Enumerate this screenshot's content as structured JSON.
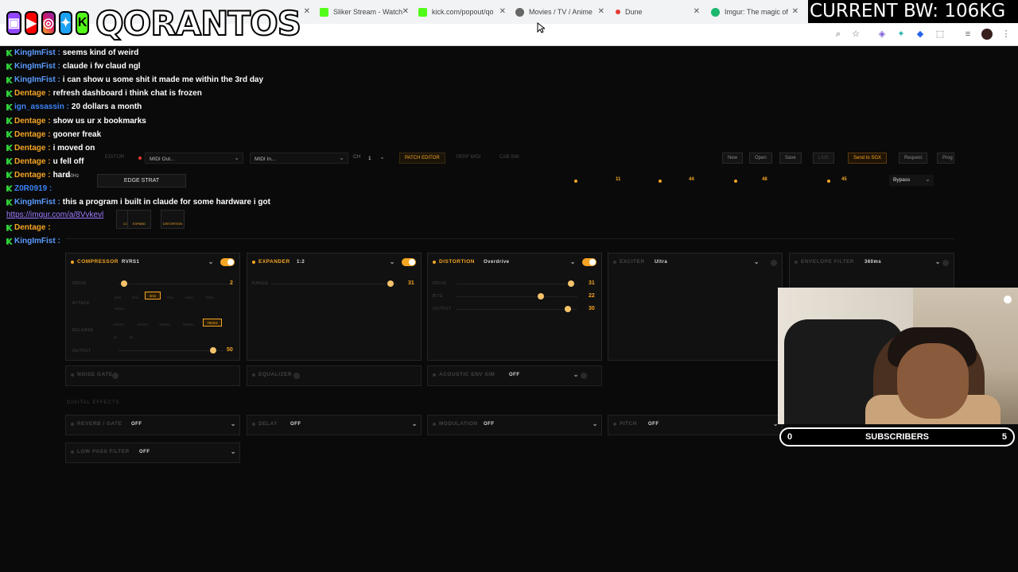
{
  "browser": {
    "tabs": [
      {
        "title": "Sliker Stream - Watch",
        "fav_color": "#53fc18"
      },
      {
        "title": "kick.com/popout/qo",
        "fav_color": "#53fc18"
      },
      {
        "title": "Movies / TV / Anime",
        "fav_color": "#666666"
      },
      {
        "title": "Dune",
        "fav_color": "#e53935"
      },
      {
        "title": "Imgur: The magic of",
        "fav_color": "#1bb76e"
      }
    ]
  },
  "overlay": {
    "channel_name": "QORANTOS",
    "bw_text": "CURRENT BW: 106KG",
    "subscribers_label": "SUBSCRIBERS",
    "subscribers_start": "0",
    "subscribers_goal": "5"
  },
  "chat": {
    "lines": [
      {
        "user": "KingImFist",
        "user_color": "#5b9bff",
        "msg": "seems kind of weird"
      },
      {
        "user": "KingImFist",
        "user_color": "#5b9bff",
        "msg": "claude i fw claud ngl"
      },
      {
        "user": "KingImFist",
        "user_color": "#5b9bff",
        "msg": "i can show u some shit it made me within the 3rd day"
      },
      {
        "user": "Dentage",
        "user_color": "#f5a524",
        "msg": "refresh dashboard i think chat is frozen"
      },
      {
        "user": "ign_assassin",
        "user_color": "#3b82f6",
        "msg": "20 dollars a month"
      },
      {
        "user": "Dentage",
        "user_color": "#f5a524",
        "msg": "show us ur x bookmarks"
      },
      {
        "user": "Dentage",
        "user_color": "#f5a524",
        "msg": "gooner freak"
      },
      {
        "user": "Dentage",
        "user_color": "#f5a524",
        "msg": "i moved on"
      },
      {
        "user": "Dentage",
        "user_color": "#f5a524",
        "msg": "u fell off"
      },
      {
        "user": "Dentage",
        "user_color": "#f5a524",
        "msg": "hard"
      },
      {
        "user": "Z0R0919",
        "user_color": "#3b82f6",
        "msg": ""
      },
      {
        "user": "KingImFist",
        "user_color": "#5b9bff",
        "msg": "this a program i built in claude for some hardware i got"
      }
    ],
    "link": "https://imgur.com/a/8Vvkevl",
    "tail": [
      {
        "user": "Dentage",
        "user_color": "#f5a524",
        "msg": ""
      },
      {
        "user": "KingImFist",
        "user_color": "#5b9bff",
        "msg": ""
      }
    ]
  },
  "app": {
    "toolbar": {
      "editor_label": "EDITOR",
      "midi_out": "MIDI Out...",
      "midi_in": "MIDI In...",
      "ch_label": "CH",
      "ch_value": "1",
      "patch_editor": "PATCH EDITOR",
      "perf_midi": "PERF MIDI",
      "cab_sim": "CAB SIM",
      "new": "New",
      "open": "Open",
      "save": "Save",
      "live": "LIVE",
      "send": "Send to SGX",
      "request": "Request",
      "prog": "Prog"
    },
    "preset": {
      "name": "EDGE STRAT",
      "v1": "11",
      "v2": "44",
      "v3": "48",
      "v4": "45",
      "bypass": "Bypass",
      "hz": "350Hz"
    },
    "chain": [
      "COMP",
      "EXPAND",
      "DISTORTION"
    ],
    "modules": {
      "compressor": {
        "name": "COMPRESSOR",
        "mode": "RVRS1",
        "drive_label": "DRIVE",
        "drive_value": "2",
        "drive_level": 0.05,
        "attack_label": "ATTACK",
        "attack_chips": [
          "2ms",
          "3ms",
          "4ms",
          "7ms",
          "14ms",
          "20ms",
          "50ms"
        ],
        "release_label": "RELEASE",
        "release_chips": [
          "100ms",
          "150ms",
          "250ms",
          "500ms",
          "750ms",
          "1s",
          "2s"
        ],
        "output_label": "OUTPUT",
        "output_value": "50",
        "output_level": 0.9
      },
      "expander": {
        "name": "EXPANDER",
        "mode": "1:2",
        "range_label": "RANGE",
        "range_value": "31",
        "range_level": 0.95
      },
      "distortion": {
        "name": "DISTORTION",
        "mode": "Overdrive",
        "drive_label": "DRIVE",
        "drive_value": "31",
        "drive_level": 0.95,
        "bite_label": "BITE",
        "bite_value": "22",
        "bite_level": 0.7,
        "output_label": "OUTPUT",
        "output_value": "30",
        "output_level": 0.92
      },
      "exciter": {
        "name": "EXCITER",
        "mode": "Ultra"
      },
      "envelope": {
        "name": "ENVELOPE FILTER",
        "mode": "360ms"
      },
      "noise_gate": {
        "name": "NOISE GATE"
      },
      "equalizer": {
        "name": "EQUALIZER"
      },
      "acoustic": {
        "name": "ACOUSTIC ENV SIM",
        "mode": "OFF"
      }
    },
    "digital_label": "DIGITAL EFFECTS",
    "digital": [
      {
        "name": "REVERB / GATE",
        "mode": "OFF"
      },
      {
        "name": "DELAY",
        "mode": "OFF"
      },
      {
        "name": "MODULATION",
        "mode": "OFF"
      },
      {
        "name": "PITCH",
        "mode": "OFF"
      },
      {
        "name": "LOW PASS FILTER",
        "mode": "OFF"
      }
    ]
  }
}
